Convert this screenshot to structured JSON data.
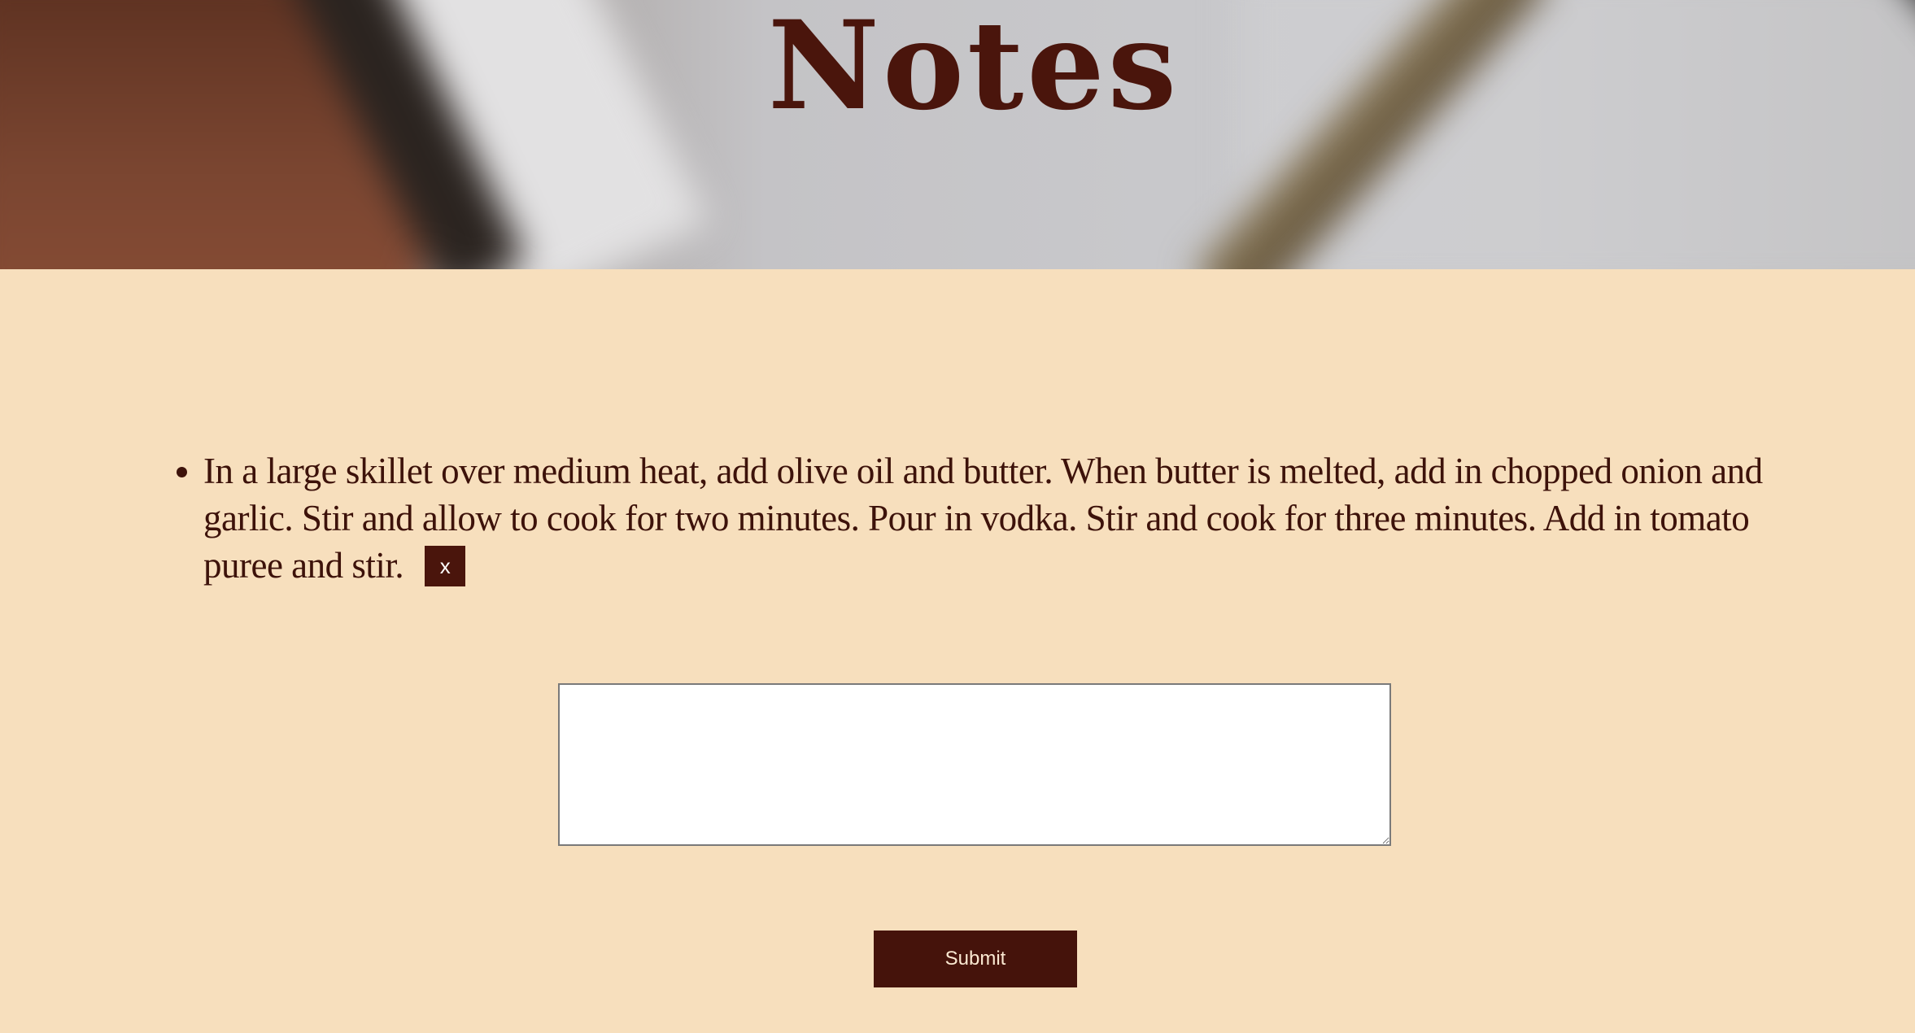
{
  "header": {
    "title": "Notes"
  },
  "notes": {
    "items": [
      {
        "text": "In a large skillet over medium heat, add olive oil and butter. When butter is melted, add in chopped onion and garlic. Stir and allow to cook for two minutes. Pour in vodka. Stir and cook for three minutes. Add in tomato puree and stir.",
        "delete_label": "x"
      }
    ]
  },
  "form": {
    "input_value": "",
    "submit_label": "Submit"
  },
  "colors": {
    "background": "#f7dfbd",
    "accent": "#45130b"
  }
}
